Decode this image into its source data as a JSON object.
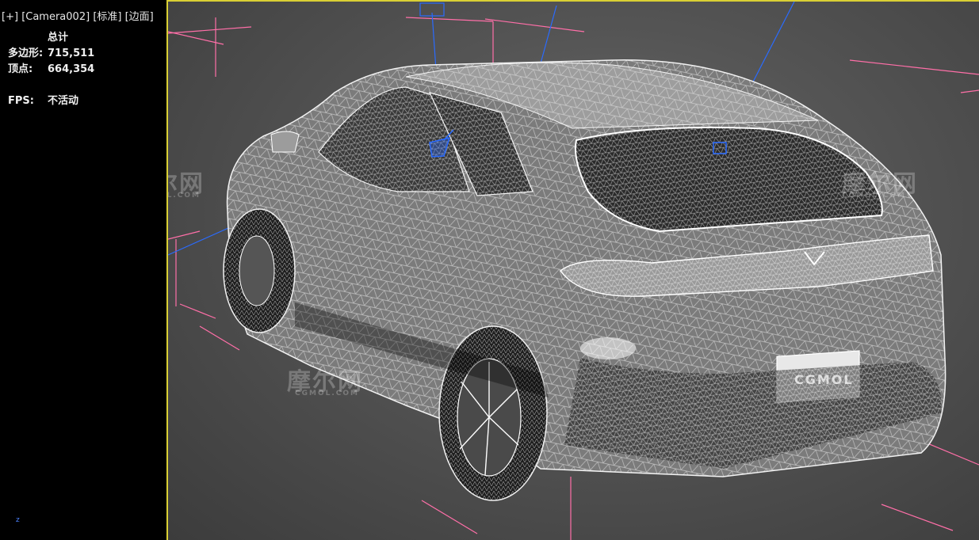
{
  "viewport": {
    "plus": "[+]",
    "camera": "[Camera002]",
    "shading": "[标准]",
    "mode": "[边面]"
  },
  "stats": {
    "title": "总计",
    "polygons_label": "多边形:",
    "polygons_value": "715,511",
    "vertices_label": "顶点:",
    "vertices_value": "664,354",
    "fps_label": "FPS:",
    "fps_value": "不活动"
  },
  "axis": {
    "z": "z"
  },
  "watermarks": {
    "brand_cn": "摩尔网",
    "brand_url": "CGMOL.COM",
    "brand_en": "CGMOL"
  },
  "colors": {
    "viewport_border": "#d9cf34",
    "helper_lines": "#ff6fa8",
    "camera_blue": "#2a6bff"
  }
}
